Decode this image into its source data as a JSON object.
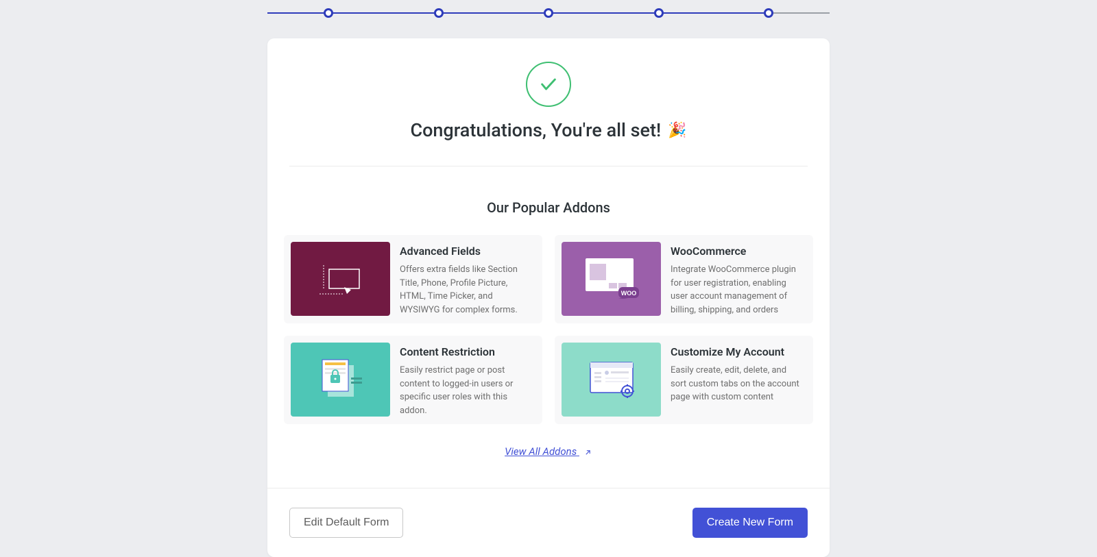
{
  "stepper": {
    "total_steps": 5,
    "completed": 5
  },
  "header": {
    "title": "Congratulations, You're all set!",
    "emoji": "🎉"
  },
  "section": {
    "title": "Our Popular Addons"
  },
  "addons": [
    {
      "title": "Advanced Fields",
      "desc": "Offers extra fields like Section Title, Phone, Profile Picture, HTML, Time Picker, and WYSIWYG for complex forms.",
      "icon": "advanced-fields-icon",
      "bg": "#711a42"
    },
    {
      "title": "WooCommerce",
      "desc": "Integrate WooCommerce plugin for user registration, enabling user account management of billing, shipping, and orders",
      "icon": "woocommerce-icon",
      "bg": "#9b5faa"
    },
    {
      "title": "Content Restriction",
      "desc": "Easily restrict page or post content to logged-in users or specific user roles with this addon.",
      "icon": "content-restriction-icon",
      "bg": "#4ec6b6"
    },
    {
      "title": "Customize My Account",
      "desc": "Easily create, edit, delete, and sort custom tabs on the account page with custom content",
      "icon": "customize-account-icon",
      "bg": "#8ddcc9"
    }
  ],
  "links": {
    "view_all": "View All Addons"
  },
  "footer": {
    "secondary_label": "Edit Default Form",
    "primary_label": "Create New Form"
  },
  "colors": {
    "accent": "#4251d6",
    "stepper": "#2e3cba",
    "success": "#3fbf72"
  }
}
